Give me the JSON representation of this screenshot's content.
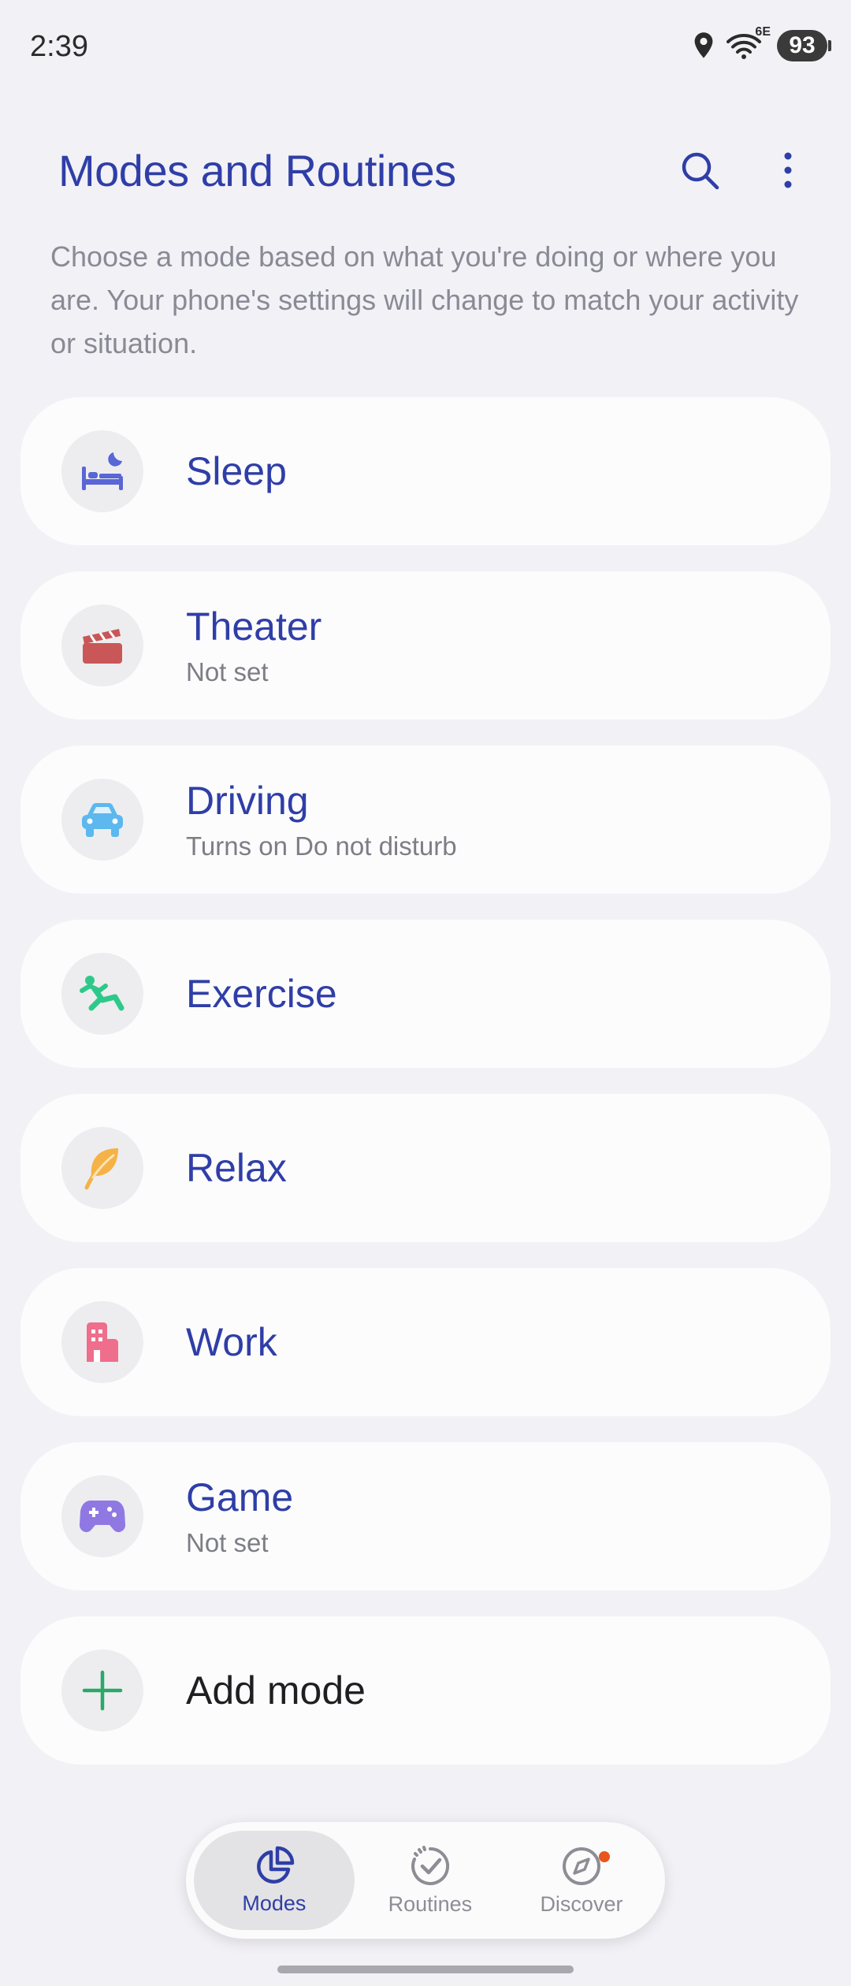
{
  "status_bar": {
    "time": "2:39",
    "battery": "93",
    "network": "6E"
  },
  "header": {
    "title": "Modes and Routines",
    "description": "Choose a mode based on what you're doing or where you are. Your phone's settings will change to match your activity or situation."
  },
  "modes": [
    {
      "label": "Sleep",
      "sub": "",
      "icon": "bed-moon-icon",
      "color": "#5866d6"
    },
    {
      "label": "Theater",
      "sub": "Not set",
      "icon": "clapperboard-icon",
      "color": "#c95757"
    },
    {
      "label": "Driving",
      "sub": "Turns on Do not disturb",
      "icon": "car-icon",
      "color": "#5cb8ee"
    },
    {
      "label": "Exercise",
      "sub": "",
      "icon": "running-icon",
      "color": "#2ec98a"
    },
    {
      "label": "Relax",
      "sub": "",
      "icon": "leaf-icon",
      "color": "#f5b246"
    },
    {
      "label": "Work",
      "sub": "",
      "icon": "building-icon",
      "color": "#ee6e8c"
    },
    {
      "label": "Game",
      "sub": "Not set",
      "icon": "gamepad-icon",
      "color": "#9078e3"
    }
  ],
  "add_mode": {
    "label": "Add mode",
    "icon": "plus-icon",
    "color": "#2aa86a"
  },
  "bottom_nav": [
    {
      "label": "Modes",
      "icon": "pie-chart-icon",
      "active": true
    },
    {
      "label": "Routines",
      "icon": "check-circle-icon",
      "active": false
    },
    {
      "label": "Discover",
      "icon": "compass-icon",
      "active": false,
      "badge": true
    }
  ],
  "colors": {
    "accent": "#2f3ea7",
    "background": "#f2f1f6",
    "card": "#fcfcfd"
  }
}
